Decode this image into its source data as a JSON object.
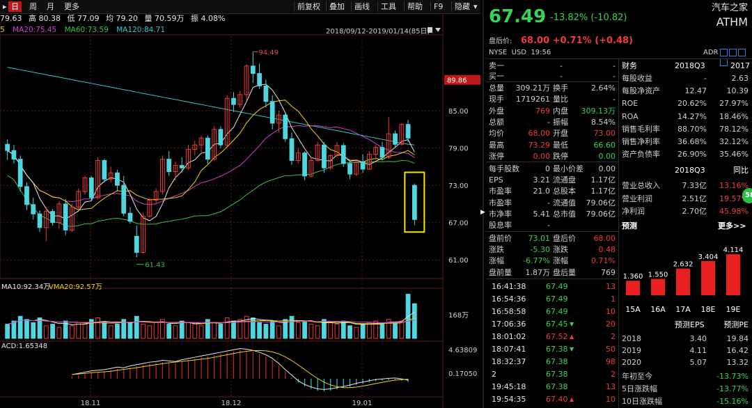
{
  "toolbar": {
    "tabs": [
      "日",
      "周",
      "月",
      "更多"
    ],
    "active_tab": "日",
    "right_items": [
      "前复权",
      "叠加",
      "画线",
      "工具",
      "帮助",
      "F9",
      "隐藏"
    ],
    "expand_glyph": "▸",
    "hide_glyph": "▾"
  },
  "quote_row": {
    "open": "79.63",
    "high_label": "高",
    "high": "80.38",
    "low_label": "低",
    "low": "77.09",
    "avg_label": "均",
    "avg": "79.20",
    "vol_label": "量",
    "vol": "70.59万",
    "amp_label": "振",
    "amp": "4.08%"
  },
  "ma_row": {
    "ma5_tail": "5",
    "ma20": "MA20:75.45",
    "ma60": "MA60:73.59",
    "ma120": "MA120:84.71"
  },
  "date_range": "2018/09/12-2019/01/14(85日)",
  "price_axis": [
    "85.00",
    "79.00",
    "73.00",
    "67.00",
    "61.00"
  ],
  "price_highlight": "89.86",
  "annot_high": "94.49",
  "annot_low": "61.43",
  "vol_header": {
    "vma10": "MA10:92.34万",
    "vma20": "VMA20:92.57万"
  },
  "vol_axis": "168万",
  "macd_header": "ACD:1.65348",
  "macd_axis": [
    "4.63809",
    "0.17050"
  ],
  "x_labels": [
    "18.11",
    "18.12",
    "19.01"
  ],
  "chart_data": {
    "type": "candlestick",
    "ylim": [
      58,
      97
    ],
    "candles": [
      [
        79.6,
        80.4,
        77.1,
        78.6
      ],
      [
        78.6,
        79.5,
        76.5,
        77.2
      ],
      [
        77.2,
        77.8,
        72.0,
        72.8
      ],
      [
        72.8,
        73.5,
        69.0,
        69.9
      ],
      [
        69.9,
        71.0,
        67.5,
        68.4
      ],
      [
        68.4,
        69.0,
        65.5,
        66.2
      ],
      [
        66.2,
        69.5,
        64.0,
        68.8
      ],
      [
        68.8,
        69.2,
        66.5,
        67.0
      ],
      [
        67.0,
        70.5,
        66.0,
        70.0
      ],
      [
        70.0,
        70.8,
        65.0,
        65.8
      ],
      [
        65.8,
        70.0,
        65.5,
        69.5
      ],
      [
        69.5,
        72.5,
        69.0,
        72.0
      ],
      [
        72.0,
        74.5,
        71.5,
        74.2
      ],
      [
        74.2,
        74.5,
        70.5,
        71.0
      ],
      [
        71.0,
        77.5,
        70.8,
        77.0
      ],
      [
        77.0,
        77.3,
        73.5,
        74.0
      ],
      [
        74.0,
        76.0,
        73.5,
        75.0
      ],
      [
        75.0,
        75.5,
        72.0,
        73.0
      ],
      [
        73.0,
        74.5,
        68.0,
        68.5
      ],
      [
        68.5,
        69.5,
        66.8,
        67.2
      ],
      [
        64.8,
        66.5,
        61.4,
        62.2
      ],
      [
        62.2,
        68.5,
        62.0,
        68.0
      ],
      [
        68.0,
        71.0,
        67.8,
        70.6
      ],
      [
        70.6,
        72.5,
        70.0,
        72.0
      ],
      [
        72.0,
        77.8,
        71.5,
        77.2
      ],
      [
        77.2,
        78.5,
        74.5,
        75.2
      ],
      [
        75.2,
        76.8,
        73.8,
        76.2
      ],
      [
        76.2,
        77.5,
        75.0,
        75.8
      ],
      [
        75.8,
        79.5,
        75.5,
        78.8
      ],
      [
        78.8,
        80.2,
        77.8,
        79.5
      ],
      [
        79.5,
        81.0,
        78.0,
        80.6
      ],
      [
        80.6,
        81.0,
        76.5,
        77.2
      ],
      [
        77.2,
        82.5,
        77.0,
        82.0
      ],
      [
        82.0,
        82.5,
        79.0,
        79.5
      ],
      [
        79.5,
        87.5,
        79.3,
        87.0
      ],
      [
        87.0,
        88.0,
        84.8,
        86.0
      ],
      [
        86.0,
        88.2,
        85.5,
        87.6
      ],
      [
        87.6,
        92.5,
        86.5,
        92.2
      ],
      [
        92.2,
        94.5,
        89.5,
        91.0
      ],
      [
        91.0,
        92.6,
        88.5,
        89.0
      ],
      [
        89.0,
        90.0,
        85.5,
        86.5
      ],
      [
        86.5,
        87.5,
        82.0,
        83.0
      ],
      [
        83.0,
        85.0,
        81.5,
        84.3
      ],
      [
        84.3,
        84.8,
        80.0,
        80.5
      ],
      [
        80.5,
        81.5,
        76.3,
        77.0
      ],
      [
        77.0,
        79.0,
        76.5,
        78.2
      ],
      [
        78.2,
        78.5,
        73.8,
        74.5
      ],
      [
        74.5,
        77.5,
        74.2,
        77.0
      ],
      [
        77.0,
        80.0,
        76.8,
        79.5
      ],
      [
        79.5,
        80.0,
        75.0,
        75.8
      ],
      [
        75.8,
        78.0,
        75.5,
        77.8
      ],
      [
        77.8,
        80.0,
        77.5,
        79.4
      ],
      [
        79.4,
        79.8,
        76.0,
        76.5
      ],
      [
        76.5,
        76.8,
        74.0,
        74.8
      ],
      [
        74.8,
        77.0,
        74.5,
        76.8
      ],
      [
        76.8,
        78.0,
        75.0,
        75.6
      ],
      [
        75.6,
        78.5,
        75.5,
        78.0
      ],
      [
        78.0,
        79.5,
        77.2,
        79.1
      ],
      [
        79.1,
        80.0,
        77.0,
        77.5
      ],
      [
        77.5,
        84.0,
        77.3,
        81.3
      ],
      [
        81.3,
        81.8,
        79.0,
        79.6
      ],
      [
        79.6,
        83.0,
        79.4,
        82.8
      ],
      [
        82.8,
        83.5,
        80.0,
        80.6
      ],
      [
        73.0,
        73.3,
        66.6,
        67.5
      ]
    ],
    "volume": [
      9,
      11,
      14,
      12,
      10,
      13,
      8,
      9,
      7,
      11,
      8,
      10,
      9,
      12,
      13,
      10,
      8,
      9,
      12,
      10,
      14,
      9,
      8,
      10,
      12,
      9,
      8,
      11,
      10,
      9,
      8,
      12,
      10,
      9,
      13,
      11,
      12,
      14,
      13,
      10,
      9,
      11,
      8,
      12,
      14,
      10,
      11,
      9,
      8,
      12,
      10,
      9,
      11,
      8,
      7,
      9,
      10,
      11,
      9,
      12,
      10,
      11,
      28,
      22
    ],
    "macd_hist": [
      0.4,
      0.6,
      0.8,
      1.0,
      1.1,
      1.2,
      1.4,
      1.6,
      1.5,
      1.8,
      2.0,
      2.2,
      2.4,
      2.5,
      2.7,
      2.6,
      2.5,
      2.8,
      3.0,
      3.2,
      3.4,
      3.6,
      3.8,
      4.0,
      4.2,
      4.4,
      4.6,
      4.5,
      4.3,
      4.0,
      3.6,
      3.0,
      2.2,
      1.2,
      0.3,
      -0.6,
      -1.2,
      -1.6,
      -1.9,
      -2.0,
      -1.9,
      -1.7,
      -1.5,
      -1.3,
      -1.0,
      -0.8,
      -0.6,
      -0.4,
      -0.3,
      -0.2,
      -0.15,
      -0.3,
      -0.5
    ],
    "series_colors": {
      "ma5": "#e8e8e8",
      "ma10": "#f5d400",
      "ma20": "#d040d0",
      "ma60": "#3fbf3f",
      "ma120": "#2fc6c6",
      "up": "#f23a3a",
      "down": "#4fd6e0"
    }
  },
  "quote": {
    "name": "汽车之家",
    "ticker": "ATHM",
    "price": "67.49",
    "change": "-13.82%",
    "change_abs": "(-10.82)",
    "after_hours_label": "盘后价:",
    "after_price": "68.00",
    "after_change": "+0.71%",
    "after_change_abs": "(+0.48)",
    "market": "NYSE",
    "currency": "USD",
    "time": "19:56",
    "adr": "ADR"
  },
  "order_book": [
    {
      "label": "卖一",
      "price": "-",
      "vol": "-"
    },
    {
      "label": "买一",
      "price": "-",
      "vol": "-"
    }
  ],
  "stats": [
    [
      "总量",
      "309.21万",
      "换手",
      "2.64%"
    ],
    [
      "现手",
      "1719261",
      "量比",
      "-"
    ],
    [
      "外盘",
      "769",
      "内盘",
      "309.13万"
    ],
    [
      "总额",
      "-",
      "振幅",
      "8.54%"
    ],
    [
      "均价",
      "68.00",
      "开盘",
      "73.00"
    ],
    [
      "最高",
      "73.29",
      "最低",
      "66.60"
    ],
    [
      "涨停",
      "0.00",
      "跌停",
      "0.00"
    ]
  ],
  "stats2": [
    [
      "每手股数",
      "0",
      "最小价差",
      "0.00"
    ],
    [
      "EPS",
      "3.21",
      "流通盘",
      "1.17亿"
    ],
    [
      "市盈率",
      "21.0",
      "总股本",
      "1.17亿"
    ],
    [
      "市盈率",
      "-",
      "流通值",
      "79.06亿"
    ],
    [
      "市净率",
      "5.41",
      "总市值",
      "79.06亿"
    ],
    [
      "股息率",
      "-",
      "",
      ""
    ]
  ],
  "stats3": [
    [
      "盘前价",
      "73.01",
      "盘后价",
      "68.00"
    ],
    [
      "涨跌",
      "-5.30",
      "涨跌",
      "0.48"
    ],
    [
      "涨幅",
      "-6.77%",
      "涨幅",
      "0.71%"
    ],
    [
      "盘前量",
      "1.87万",
      "盘后量",
      "769"
    ]
  ],
  "ticks": [
    {
      "time": "16:41:38",
      "price": "67.49",
      "dir": "",
      "vol": "13"
    },
    {
      "time": "16:54:36",
      "price": "67.49",
      "dir": "",
      "vol": "1"
    },
    {
      "time": "16:58:58",
      "price": "67.49",
      "dir": "",
      "vol": "10"
    },
    {
      "time": "17:06:36",
      "price": "67.45",
      "dir": "down",
      "vol": "20"
    },
    {
      "time": "18:01:02",
      "price": "67.52",
      "dir": "up",
      "vol": "2"
    },
    {
      "time": "18:07:41",
      "price": "67.38",
      "dir": "down",
      "vol": "50"
    },
    {
      "time": "18:32:37",
      "price": "67.38",
      "dir": "",
      "vol": "98"
    },
    {
      "time": "2",
      "price": "67.38",
      "dir": "",
      "vol": "2"
    },
    {
      "time": "19:45:18",
      "price": "67.38",
      "dir": "",
      "vol": "13"
    },
    {
      "time": "19:54:35",
      "price": "67.40",
      "dir": "up",
      "vol": "10"
    }
  ],
  "finance": {
    "title": "财务",
    "period": "2018Q3",
    "period2": "2017",
    "rows": [
      [
        "每股收益",
        "-",
        "2.63"
      ],
      [
        "每股净资产",
        "12.47",
        "10.39"
      ],
      [
        "ROE",
        "20.62%",
        "27.97%"
      ],
      [
        "ROA",
        "14.27%",
        "18.46%"
      ],
      [
        "销售毛利率",
        "88.70%",
        "78.12%"
      ],
      [
        "销售净利率",
        "36.68%",
        "32.12%"
      ],
      [
        "资产负债率",
        "26.90%",
        "35.46%"
      ]
    ],
    "period3": "2018Q3",
    "period4": "同比",
    "rows2": [
      [
        "营业总收入",
        "7.33亿",
        "13.16%"
      ],
      [
        "营业利润",
        "2.51亿",
        "19.57%"
      ],
      [
        "净利润",
        "2.70亿",
        "45.98%"
      ]
    ],
    "side_badge": "58"
  },
  "forecast": {
    "title": "预测",
    "more": "更多>>",
    "bars": [
      {
        "year": "15A",
        "value": 1.36,
        "label": "1.360"
      },
      {
        "year": "16A",
        "value": 1.55,
        "label": "1.550"
      },
      {
        "year": "17A",
        "value": 2.632,
        "label": "2.632"
      },
      {
        "year": "18E",
        "value": 3.404,
        "label": "3.404"
      },
      {
        "year": "19E",
        "value": 4.114,
        "label": "4.114"
      }
    ],
    "head_eps": "预测EPS",
    "head_pe": "预测PE",
    "rows": [
      [
        "2018",
        "3.40",
        "19.84"
      ],
      [
        "2019",
        "4.11",
        "16.42"
      ],
      [
        "2020",
        "5.07",
        "13.32"
      ]
    ],
    "perf": [
      [
        "年初至今",
        "-13.73%"
      ],
      [
        "5日涨跌幅",
        "-13.77%"
      ],
      [
        "10日涨跌幅",
        "-15.16%"
      ]
    ]
  }
}
